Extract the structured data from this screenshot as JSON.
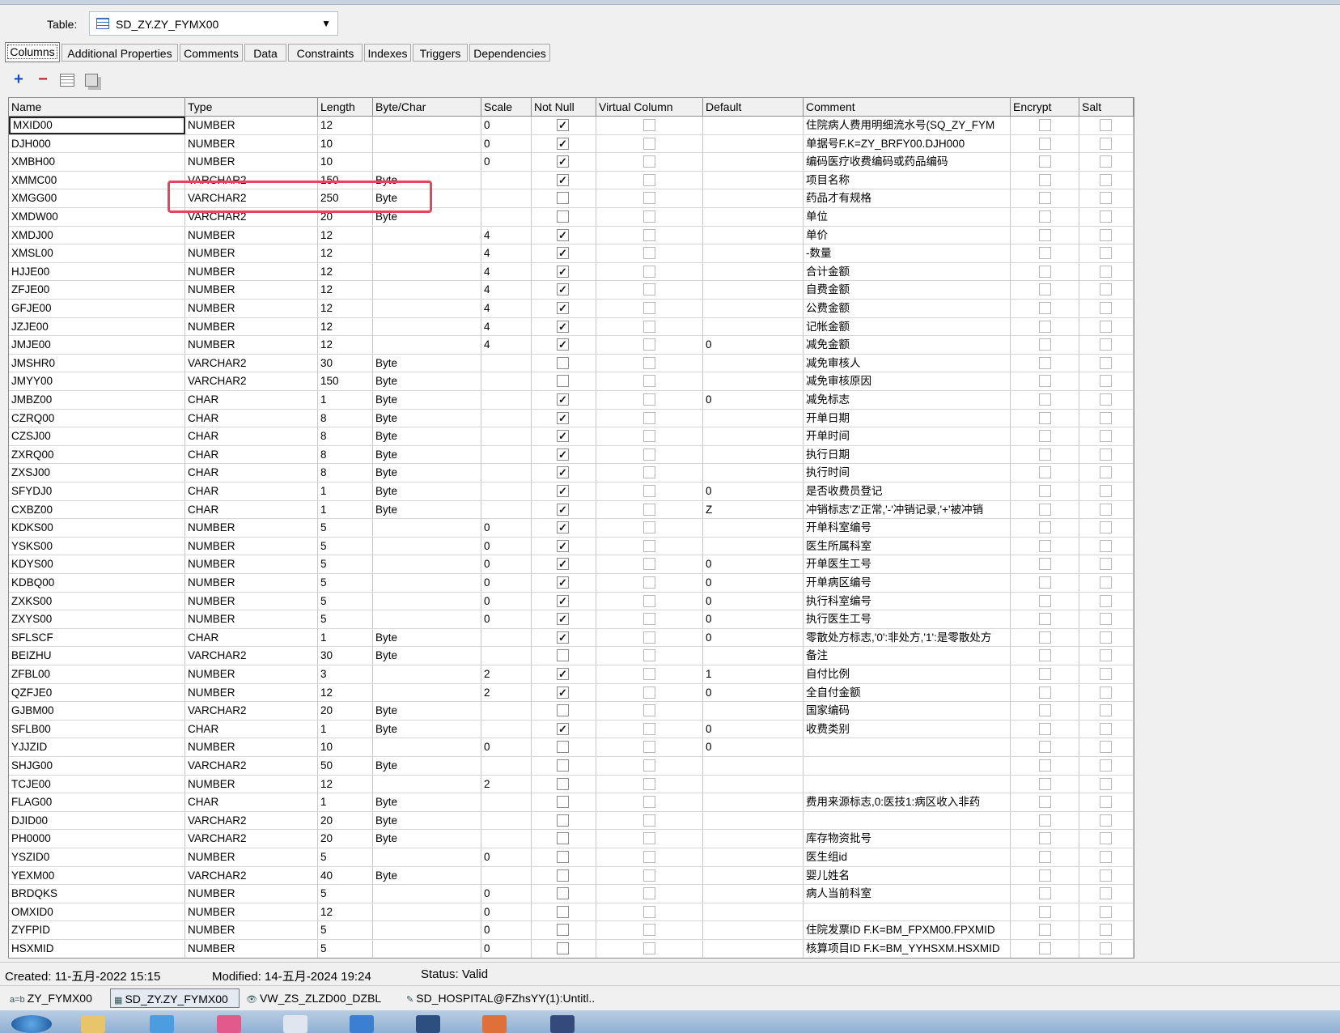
{
  "table_selector": {
    "label": "Table:",
    "value": "SD_ZY.ZY_FYMX00"
  },
  "tabs": [
    "Columns",
    "Additional Properties",
    "Comments",
    "Data",
    "Constraints",
    "Indexes",
    "Triggers",
    "Dependencies"
  ],
  "toolbar": {
    "add": "+",
    "remove": "−"
  },
  "columns_header": [
    "Name",
    "Type",
    "Length",
    "Byte/Char",
    "Scale",
    "Not Null",
    "Virtual Column",
    "Default",
    "Comment",
    "Encrypt",
    "Salt"
  ],
  "rows": [
    {
      "name": "MXID00",
      "type": "NUMBER",
      "length": "12",
      "bytechar": "",
      "scale": "0",
      "notnull": true,
      "default": "",
      "comment": "住院病人费用明细流水号(SQ_ZY_FYM"
    },
    {
      "name": "DJH000",
      "type": "NUMBER",
      "length": "10",
      "bytechar": "",
      "scale": "0",
      "notnull": true,
      "default": "",
      "comment": "单据号F.K=ZY_BRFY00.DJH000"
    },
    {
      "name": "XMBH00",
      "type": "NUMBER",
      "length": "10",
      "bytechar": "",
      "scale": "0",
      "notnull": true,
      "default": "",
      "comment": "编码医疗收费编码或药品编码"
    },
    {
      "name": "XMMC00",
      "type": "VARCHAR2",
      "length": "150",
      "bytechar": "Byte",
      "scale": "",
      "notnull": true,
      "default": "",
      "comment": "项目名称"
    },
    {
      "name": "XMGG00",
      "type": "VARCHAR2",
      "length": "250",
      "bytechar": "Byte",
      "scale": "",
      "notnull": false,
      "default": "",
      "comment": "药品才有规格"
    },
    {
      "name": "XMDW00",
      "type": "VARCHAR2",
      "length": "20",
      "bytechar": "Byte",
      "scale": "",
      "notnull": false,
      "default": "",
      "comment": "单位"
    },
    {
      "name": "XMDJ00",
      "type": "NUMBER",
      "length": "12",
      "bytechar": "",
      "scale": "4",
      "notnull": true,
      "default": "",
      "comment": "单价"
    },
    {
      "name": "XMSL00",
      "type": "NUMBER",
      "length": "12",
      "bytechar": "",
      "scale": "4",
      "notnull": true,
      "default": "",
      "comment": "-数量"
    },
    {
      "name": "HJJE00",
      "type": "NUMBER",
      "length": "12",
      "bytechar": "",
      "scale": "4",
      "notnull": true,
      "default": "",
      "comment": "合计金额"
    },
    {
      "name": "ZFJE00",
      "type": "NUMBER",
      "length": "12",
      "bytechar": "",
      "scale": "4",
      "notnull": true,
      "default": "",
      "comment": "自费金额"
    },
    {
      "name": "GFJE00",
      "type": "NUMBER",
      "length": "12",
      "bytechar": "",
      "scale": "4",
      "notnull": true,
      "default": "",
      "comment": "公费金额"
    },
    {
      "name": "JZJE00",
      "type": "NUMBER",
      "length": "12",
      "bytechar": "",
      "scale": "4",
      "notnull": true,
      "default": "",
      "comment": "记帐金额"
    },
    {
      "name": "JMJE00",
      "type": "NUMBER",
      "length": "12",
      "bytechar": "",
      "scale": "4",
      "notnull": true,
      "default": "0",
      "comment": "减免金额"
    },
    {
      "name": "JMSHR0",
      "type": "VARCHAR2",
      "length": "30",
      "bytechar": "Byte",
      "scale": "",
      "notnull": false,
      "default": "",
      "comment": "减免审核人"
    },
    {
      "name": "JMYY00",
      "type": "VARCHAR2",
      "length": "150",
      "bytechar": "Byte",
      "scale": "",
      "notnull": false,
      "default": "",
      "comment": "减免审核原因"
    },
    {
      "name": "JMBZ00",
      "type": "CHAR",
      "length": "1",
      "bytechar": "Byte",
      "scale": "",
      "notnull": true,
      "default": "0",
      "comment": "减免标志"
    },
    {
      "name": "CZRQ00",
      "type": "CHAR",
      "length": "8",
      "bytechar": "Byte",
      "scale": "",
      "notnull": true,
      "default": "",
      "comment": "开单日期"
    },
    {
      "name": "CZSJ00",
      "type": "CHAR",
      "length": "8",
      "bytechar": "Byte",
      "scale": "",
      "notnull": true,
      "default": "",
      "comment": "开单时间"
    },
    {
      "name": "ZXRQ00",
      "type": "CHAR",
      "length": "8",
      "bytechar": "Byte",
      "scale": "",
      "notnull": true,
      "default": "",
      "comment": "执行日期"
    },
    {
      "name": "ZXSJ00",
      "type": "CHAR",
      "length": "8",
      "bytechar": "Byte",
      "scale": "",
      "notnull": true,
      "default": "",
      "comment": "执行时间"
    },
    {
      "name": "SFYDJ0",
      "type": "CHAR",
      "length": "1",
      "bytechar": "Byte",
      "scale": "",
      "notnull": true,
      "default": "0",
      "comment": "是否收费员登记"
    },
    {
      "name": "CXBZ00",
      "type": "CHAR",
      "length": "1",
      "bytechar": "Byte",
      "scale": "",
      "notnull": true,
      "default": "Z",
      "comment": "冲销标志'Z'正常,'-'冲销记录,'+'被冲销"
    },
    {
      "name": "KDKS00",
      "type": "NUMBER",
      "length": "5",
      "bytechar": "",
      "scale": "0",
      "notnull": true,
      "default": "",
      "comment": "开单科室编号"
    },
    {
      "name": "YSKS00",
      "type": "NUMBER",
      "length": "5",
      "bytechar": "",
      "scale": "0",
      "notnull": true,
      "default": "",
      "comment": "医生所属科室"
    },
    {
      "name": "KDYS00",
      "type": "NUMBER",
      "length": "5",
      "bytechar": "",
      "scale": "0",
      "notnull": true,
      "default": "0",
      "comment": "开单医生工号"
    },
    {
      "name": "KDBQ00",
      "type": "NUMBER",
      "length": "5",
      "bytechar": "",
      "scale": "0",
      "notnull": true,
      "default": "0",
      "comment": "开单病区编号"
    },
    {
      "name": "ZXKS00",
      "type": "NUMBER",
      "length": "5",
      "bytechar": "",
      "scale": "0",
      "notnull": true,
      "default": "0",
      "comment": "执行科室编号"
    },
    {
      "name": "ZXYS00",
      "type": "NUMBER",
      "length": "5",
      "bytechar": "",
      "scale": "0",
      "notnull": true,
      "default": "0",
      "comment": "执行医生工号"
    },
    {
      "name": "SFLSCF",
      "type": "CHAR",
      "length": "1",
      "bytechar": "Byte",
      "scale": "",
      "notnull": true,
      "default": "0",
      "comment": "零散处方标志,'0':非处方,'1':是零散处方"
    },
    {
      "name": "BEIZHU",
      "type": "VARCHAR2",
      "length": "30",
      "bytechar": "Byte",
      "scale": "",
      "notnull": false,
      "default": "",
      "comment": "备注"
    },
    {
      "name": "ZFBL00",
      "type": "NUMBER",
      "length": "3",
      "bytechar": "",
      "scale": "2",
      "notnull": true,
      "default": "1",
      "comment": "自付比例"
    },
    {
      "name": "QZFJE0",
      "type": "NUMBER",
      "length": "12",
      "bytechar": "",
      "scale": "2",
      "notnull": true,
      "default": "0",
      "comment": "全自付金额"
    },
    {
      "name": "GJBM00",
      "type": "VARCHAR2",
      "length": "20",
      "bytechar": "Byte",
      "scale": "",
      "notnull": false,
      "default": "",
      "comment": "国家编码"
    },
    {
      "name": "SFLB00",
      "type": "CHAR",
      "length": "1",
      "bytechar": "Byte",
      "scale": "",
      "notnull": true,
      "default": "0",
      "comment": "收费类别"
    },
    {
      "name": "YJJZID",
      "type": "NUMBER",
      "length": "10",
      "bytechar": "",
      "scale": "0",
      "notnull": false,
      "default": "0",
      "comment": ""
    },
    {
      "name": "SHJG00",
      "type": "VARCHAR2",
      "length": "50",
      "bytechar": "Byte",
      "scale": "",
      "notnull": false,
      "default": "",
      "comment": ""
    },
    {
      "name": "TCJE00",
      "type": "NUMBER",
      "length": "12",
      "bytechar": "",
      "scale": "2",
      "notnull": false,
      "default": "",
      "comment": ""
    },
    {
      "name": "FLAG00",
      "type": "CHAR",
      "length": "1",
      "bytechar": "Byte",
      "scale": "",
      "notnull": false,
      "default": "",
      "comment": "费用来源标志,0:医技1:病区收入非药"
    },
    {
      "name": "DJID00",
      "type": "VARCHAR2",
      "length": "20",
      "bytechar": "Byte",
      "scale": "",
      "notnull": false,
      "default": "",
      "comment": ""
    },
    {
      "name": "PH0000",
      "type": "VARCHAR2",
      "length": "20",
      "bytechar": "Byte",
      "scale": "",
      "notnull": false,
      "default": "",
      "comment": "库存物资批号"
    },
    {
      "name": "YSZID0",
      "type": "NUMBER",
      "length": "5",
      "bytechar": "",
      "scale": "0",
      "notnull": false,
      "default": "",
      "comment": "医生组id"
    },
    {
      "name": "YEXM00",
      "type": "VARCHAR2",
      "length": "40",
      "bytechar": "Byte",
      "scale": "",
      "notnull": false,
      "default": "",
      "comment": "婴儿姓名"
    },
    {
      "name": "BRDQKS",
      "type": "NUMBER",
      "length": "5",
      "bytechar": "",
      "scale": "0",
      "notnull": false,
      "default": "",
      "comment": "病人当前科室"
    },
    {
      "name": "OMXID0",
      "type": "NUMBER",
      "length": "12",
      "bytechar": "",
      "scale": "0",
      "notnull": false,
      "default": "",
      "comment": ""
    },
    {
      "name": "ZYFPID",
      "type": "NUMBER",
      "length": "5",
      "bytechar": "",
      "scale": "0",
      "notnull": false,
      "default": "",
      "comment": "住院发票ID F.K=BM_FPXM00.FPXMID"
    },
    {
      "name": "HSXMID",
      "type": "NUMBER",
      "length": "5",
      "bytechar": "",
      "scale": "0",
      "notnull": false,
      "default": "",
      "comment": "核算项目ID F.K=BM_YYHSXM.HSXMID"
    }
  ],
  "status": {
    "created": "Created: 11-五月-2022 15:15",
    "modified": "Modified: 14-五月-2024 19:24",
    "state": "Status: Valid"
  },
  "window_tabs": [
    "ZY_FYMX00",
    "SD_ZY.ZY_FYMX00",
    "VW_ZS_ZLZD00_DZBL",
    "SD_HOSPITAL@FZhsYY(1):Untitl.."
  ],
  "colors": {
    "highlight": "#e8445a",
    "add": "#1f4fbf",
    "remove": "#c0202a"
  }
}
